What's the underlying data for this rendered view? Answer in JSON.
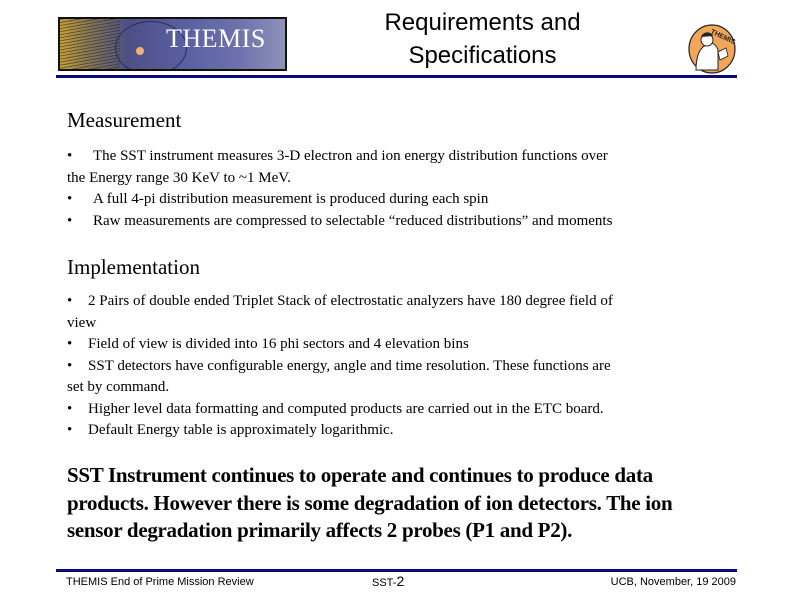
{
  "header": {
    "logo_text": "THEMIS",
    "title_line1": "Requirements and",
    "title_line2": "Specifications",
    "badge_text": "THEMIS",
    "rule_color": "#0a0a7a"
  },
  "measurement": {
    "heading": "Measurement",
    "bullets": [
      {
        "bullet": "•",
        "line1": "The SST instrument measures 3-D electron and ion energy distribution functions over",
        "line2": "the  Energy range 30 KeV to ~1 MeV."
      },
      {
        "bullet": "•",
        "line1": "A full 4-pi distribution measurement is produced during each spin"
      },
      {
        "bullet": "•",
        "line1": "Raw measurements are compressed to selectable “reduced distributions” and moments"
      }
    ]
  },
  "implementation": {
    "heading": "Implementation",
    "bullets": [
      {
        "bullet": "•",
        "line1": "2 Pairs of double ended Triplet Stack of electrostatic analyzers have 180 degree field of",
        "line2": "view"
      },
      {
        "bullet": "•",
        "line1": "Field of view is divided into 16 phi sectors and 4 elevation bins"
      },
      {
        "bullet": "•",
        "line1": "SST detectors have configurable energy, angle and time resolution. These functions are",
        "line2": "set by command."
      },
      {
        "bullet": "•",
        "line1": "Higher level data formatting and computed products are carried out in the ETC board."
      },
      {
        "bullet": "•",
        "line1": "Default Energy table is approximately logarithmic."
      }
    ]
  },
  "summary": {
    "line1": "SST Instrument continues to operate and continues to produce data",
    "line2": "products. However there is some degradation of ion detectors. The ion",
    "line3": "sensor degradation primarily affects 2 probes (P1 and P2)."
  },
  "footer": {
    "left": "THEMIS End of Prime Mission Review",
    "center_prefix": "SST-",
    "center_number": "2",
    "right": "UCB, November, 19 2009"
  }
}
